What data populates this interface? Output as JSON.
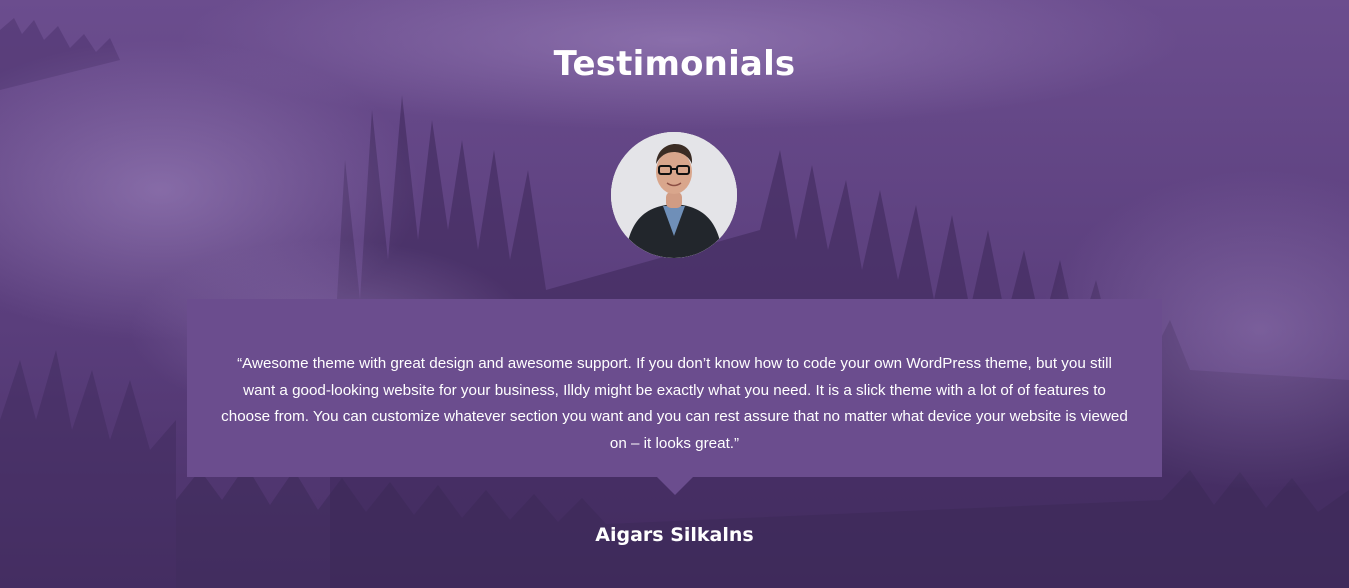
{
  "section": {
    "title": "Testimonials"
  },
  "testimonial": {
    "quote": "“Awesome theme with great design and awesome support. If you don’t know how to code your own WordPress theme, but you still want a good-looking website for your business, Illdy might be exactly what you need. It is a slick theme with a lot of of features to choose from. You can customize whatever section you want and you can rest assure that no matter what device your website is viewed on – it looks great.”",
    "author": "Aigars Silkalns",
    "avatar_alt": "Aigars Silkalns"
  },
  "colors": {
    "overlay": "#6b4d8e",
    "quote_box": "#6b4d8e",
    "text": "#ffffff"
  }
}
